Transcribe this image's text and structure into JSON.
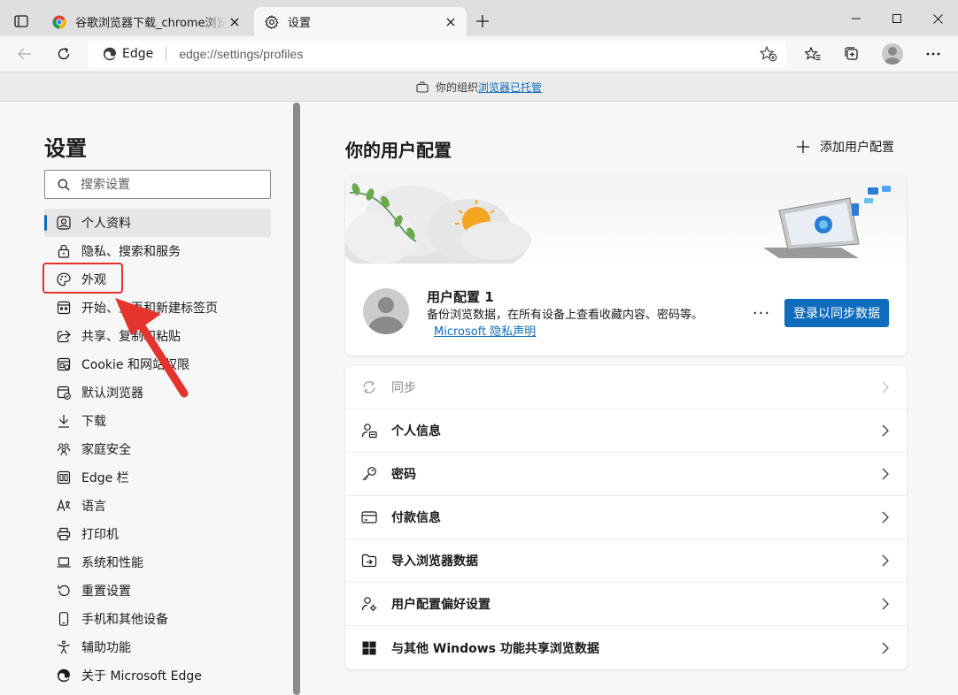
{
  "tabs": [
    {
      "title": "谷歌浏览器下载_chrome浏览器官方下载",
      "close": "关闭"
    },
    {
      "title": "设置",
      "close": "关闭"
    }
  ],
  "toolbar": {
    "site_name": "Edge",
    "url": "edge://settings/profiles"
  },
  "managed_bar": {
    "prefix": "你的组织",
    "link": "浏览器已托管"
  },
  "sidebar": {
    "title": "设置",
    "search_placeholder": "搜索设置",
    "items": [
      {
        "label": "个人资料",
        "icon": "profile-icon",
        "selected": true
      },
      {
        "label": "隐私、搜索和服务",
        "icon": "lock-icon"
      },
      {
        "label": "外观",
        "icon": "palette-icon"
      },
      {
        "label": "开始、主页和新建标签页",
        "icon": "home-icon"
      },
      {
        "label": "共享、复制和粘贴",
        "icon": "share-icon"
      },
      {
        "label": "Cookie 和网站权限",
        "icon": "site-permissions-icon"
      },
      {
        "label": "默认浏览器",
        "icon": "default-browser-icon"
      },
      {
        "label": "下载",
        "icon": "download-icon"
      },
      {
        "label": "家庭安全",
        "icon": "family-icon"
      },
      {
        "label": "Edge 栏",
        "icon": "edge-bar-icon"
      },
      {
        "label": "语言",
        "icon": "language-icon"
      },
      {
        "label": "打印机",
        "icon": "printer-icon"
      },
      {
        "label": "系统和性能",
        "icon": "laptop-icon"
      },
      {
        "label": "重置设置",
        "icon": "reset-icon"
      },
      {
        "label": "手机和其他设备",
        "icon": "phone-icon"
      },
      {
        "label": "辅助功能",
        "icon": "accessibility-icon"
      },
      {
        "label": "关于 Microsoft Edge",
        "icon": "edge-logo-icon"
      }
    ]
  },
  "main": {
    "title": "你的用户配置",
    "add_profile": "添加用户配置",
    "profile": {
      "name": "用户配置 1",
      "desc": "备份浏览数据，在所有设备上查看收藏内容、密码等。",
      "privacy_link": "Microsoft 隐私声明",
      "more": "···",
      "sync_button": "登录以同步数据"
    },
    "rows": [
      {
        "label": "同步",
        "icon": "sync-icon",
        "disabled": true
      },
      {
        "label": "个人信息",
        "icon": "personal-info-icon"
      },
      {
        "label": "密码",
        "icon": "key-icon"
      },
      {
        "label": "付款信息",
        "icon": "card-icon"
      },
      {
        "label": "导入浏览器数据",
        "icon": "import-icon"
      },
      {
        "label": "用户配置偏好设置",
        "icon": "profile-prefs-icon"
      },
      {
        "label": "与其他 Windows 功能共享浏览数据",
        "icon": "windows-icon"
      }
    ]
  },
  "colors": {
    "accent": "#0f6cbd",
    "annotation": "#e5342d"
  }
}
